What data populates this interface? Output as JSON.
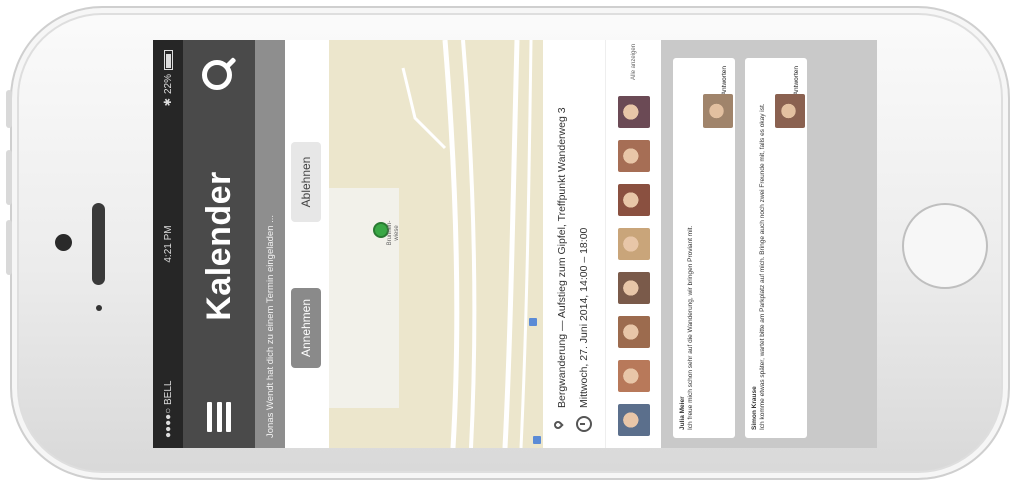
{
  "status_bar": {
    "carrier": "●●●●○ BELL",
    "wifi": "wifi-icon",
    "time": "4:21 PM",
    "bluetooth": "bluetooth-icon",
    "battery_percent": "22%"
  },
  "header": {
    "title": "Kalender",
    "menu_icon": "hamburger-icon",
    "search_icon": "search-icon"
  },
  "subtitle": "Jonas Wendt hat dich zu einem Termin eingeladen ... ",
  "map": {
    "accept_label": "Annehmen",
    "reject_label": "Ablehnen",
    "pin_label": "Brunnen- wiese"
  },
  "details": {
    "location": "Bergwanderung — Aufstieg zum Gipfel, Treffpunkt Wanderweg 3",
    "datetime": "Mittwoch, 27. Juni 2014, 14:00 – 18:00"
  },
  "attendees": {
    "colors": [
      "#5b6f8c",
      "#b8795a",
      "#9c6b4e",
      "#7a5a4a",
      "#c9a57a",
      "#8a5040",
      "#a66e55",
      "#6b4a55"
    ],
    "more_label": "Alle anzeigen"
  },
  "comments": [
    {
      "name": "Julia Meier",
      "text": "Ich freue mich schon sehr auf die Wanderung, wir bringen Proviant mit.",
      "reply": "Antworten",
      "avatar_color": "#a0846b"
    },
    {
      "name": "Simon Krause",
      "text": "Ich komme etwas später, wartet bitte am Parkplatz auf mich. Bringe auch noch zwei Freunde mit, falls es okay ist.",
      "reply": "Antworten",
      "avatar_color": "#8a6150"
    }
  ]
}
